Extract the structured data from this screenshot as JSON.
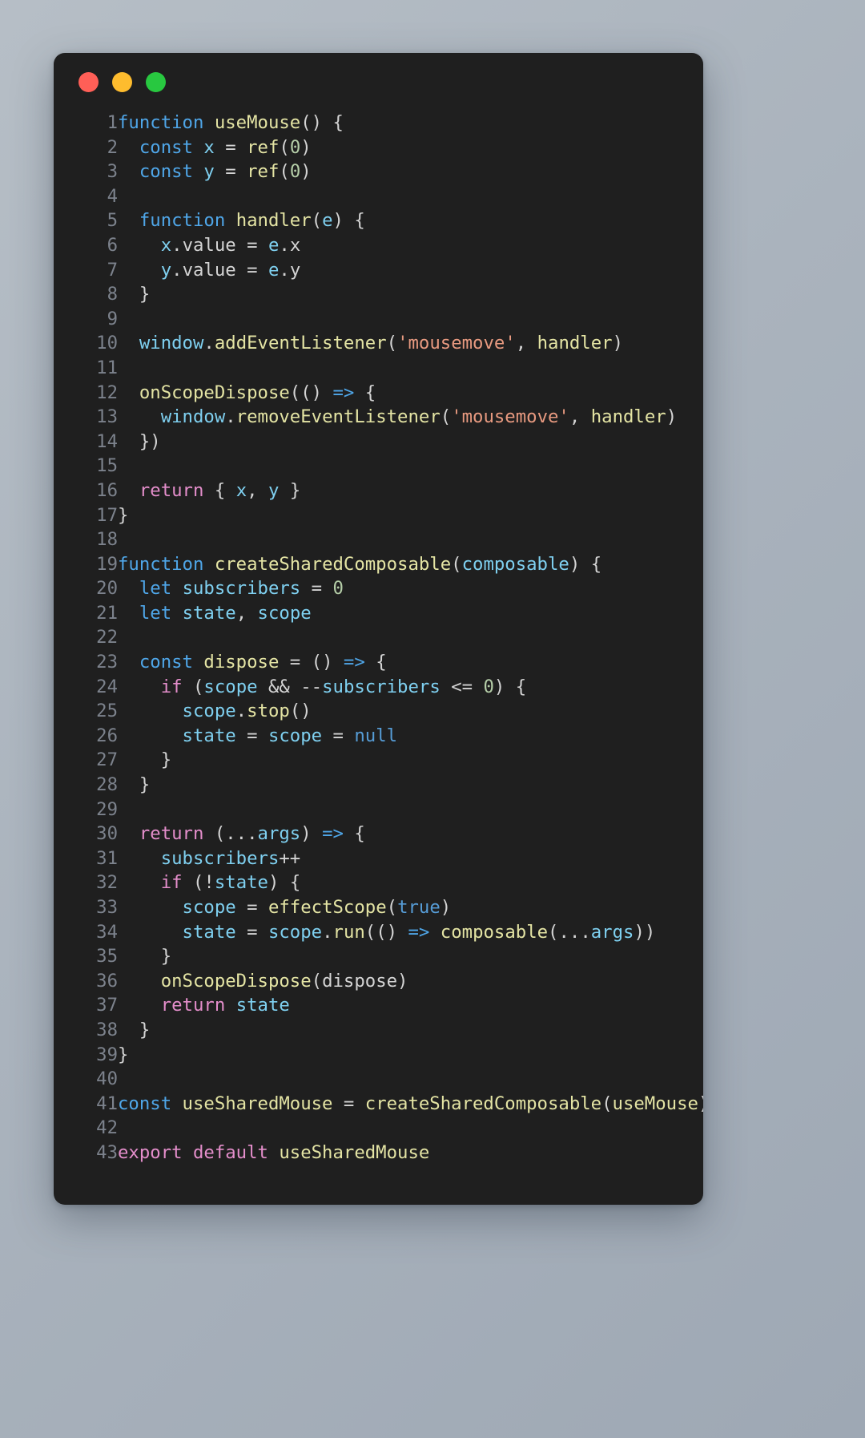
{
  "window": {
    "traffic_lights": [
      {
        "name": "close-button",
        "color": "#ff5f57"
      },
      {
        "name": "minimize-button",
        "color": "#febc2e"
      },
      {
        "name": "maximize-button",
        "color": "#28c840"
      }
    ],
    "background": "#1f1f1f"
  },
  "theme": {
    "page_background_start": "#b6bec6",
    "page_background_end": "#9ea8b4",
    "keyword": "#4fa6e8",
    "control": "#e48ecb",
    "function": "#e4e4a4",
    "variable": "#7fd0f0",
    "number": "#b5cea8",
    "string": "#e89a80",
    "literal": "#569cd6",
    "plain": "#d4d4d4",
    "line_number": "#7c828c"
  },
  "code": {
    "language": "javascript",
    "line_numbers": [
      "1",
      "2",
      "3",
      "4",
      "5",
      "6",
      "7",
      "8",
      "9",
      "10",
      "11",
      "12",
      "13",
      "14",
      "15",
      "16",
      "17",
      "18",
      "19",
      "20",
      "21",
      "22",
      "23",
      "24",
      "25",
      "26",
      "27",
      "28",
      "29",
      "30",
      "31",
      "32",
      "33",
      "34",
      "35",
      "36",
      "37",
      "38",
      "39",
      "40",
      "41",
      "42",
      "43"
    ],
    "lines": [
      "function useMouse() {",
      "  const x = ref(0)",
      "  const y = ref(0)",
      "",
      "  function handler(e) {",
      "    x.value = e.x",
      "    y.value = e.y",
      "  }",
      "",
      "  window.addEventListener('mousemove', handler)",
      "",
      "  onScopeDispose(() => {",
      "    window.removeEventListener('mousemove', handler)",
      "  })",
      "",
      "  return { x, y }",
      "}",
      "",
      "function createSharedComposable(composable) {",
      "  let subscribers = 0",
      "  let state, scope",
      "",
      "  const dispose = () => {",
      "    if (scope && --subscribers <= 0) {",
      "      scope.stop()",
      "      state = scope = null",
      "    }",
      "  }",
      "",
      "  return (...args) => {",
      "    subscribers++",
      "    if (!state) {",
      "      scope = effectScope(true)",
      "      state = scope.run(() => composable(...args))",
      "    }",
      "    onScopeDispose(dispose)",
      "    return state",
      "  }",
      "}",
      "",
      "const useSharedMouse = createSharedComposable(useMouse)",
      "",
      "export default useSharedMouse"
    ],
    "tokens": [
      [
        [
          "function ",
          "kw"
        ],
        [
          "useMouse",
          "fn"
        ],
        [
          "() {",
          "op"
        ]
      ],
      [
        [
          "  ",
          "pln"
        ],
        [
          "const ",
          "kw"
        ],
        [
          "x",
          "var"
        ],
        [
          " = ",
          "op"
        ],
        [
          "ref",
          "fn"
        ],
        [
          "(",
          "op"
        ],
        [
          "0",
          "num"
        ],
        [
          ")",
          "op"
        ]
      ],
      [
        [
          "  ",
          "pln"
        ],
        [
          "const ",
          "kw"
        ],
        [
          "y",
          "var"
        ],
        [
          " = ",
          "op"
        ],
        [
          "ref",
          "fn"
        ],
        [
          "(",
          "op"
        ],
        [
          "0",
          "num"
        ],
        [
          ")",
          "op"
        ]
      ],
      [
        [
          "",
          "pln"
        ]
      ],
      [
        [
          "  ",
          "pln"
        ],
        [
          "function ",
          "kw"
        ],
        [
          "handler",
          "fn"
        ],
        [
          "(",
          "op"
        ],
        [
          "e",
          "var"
        ],
        [
          ") {",
          "op"
        ]
      ],
      [
        [
          "    ",
          "pln"
        ],
        [
          "x",
          "var"
        ],
        [
          ".value = ",
          "op"
        ],
        [
          "e",
          "var"
        ],
        [
          ".x",
          "op"
        ]
      ],
      [
        [
          "    ",
          "pln"
        ],
        [
          "y",
          "var"
        ],
        [
          ".value = ",
          "op"
        ],
        [
          "e",
          "var"
        ],
        [
          ".y",
          "op"
        ]
      ],
      [
        [
          "  }",
          "op"
        ]
      ],
      [
        [
          "",
          "pln"
        ]
      ],
      [
        [
          "  ",
          "pln"
        ],
        [
          "window",
          "var"
        ],
        [
          ".",
          "op"
        ],
        [
          "addEventListener",
          "fn"
        ],
        [
          "(",
          "op"
        ],
        [
          "'mousemove'",
          "str"
        ],
        [
          ", ",
          "op"
        ],
        [
          "handler",
          "fn"
        ],
        [
          ")",
          "op"
        ]
      ],
      [
        [
          "",
          "pln"
        ]
      ],
      [
        [
          "  ",
          "pln"
        ],
        [
          "onScopeDispose",
          "fn"
        ],
        [
          "(() ",
          "op"
        ],
        [
          "=>",
          "arw"
        ],
        [
          " {",
          "op"
        ]
      ],
      [
        [
          "    ",
          "pln"
        ],
        [
          "window",
          "var"
        ],
        [
          ".",
          "op"
        ],
        [
          "removeEventListener",
          "fn"
        ],
        [
          "(",
          "op"
        ],
        [
          "'mousemove'",
          "str"
        ],
        [
          ", ",
          "op"
        ],
        [
          "handler",
          "fn"
        ],
        [
          ")",
          "op"
        ]
      ],
      [
        [
          "  })",
          "op"
        ]
      ],
      [
        [
          "",
          "pln"
        ]
      ],
      [
        [
          "  ",
          "pln"
        ],
        [
          "return",
          "ctl"
        ],
        [
          " { ",
          "op"
        ],
        [
          "x",
          "var"
        ],
        [
          ", ",
          "op"
        ],
        [
          "y",
          "var"
        ],
        [
          " }",
          "op"
        ]
      ],
      [
        [
          "}",
          "op"
        ]
      ],
      [
        [
          "",
          "pln"
        ]
      ],
      [
        [
          "function ",
          "kw"
        ],
        [
          "createSharedComposable",
          "fn"
        ],
        [
          "(",
          "op"
        ],
        [
          "composable",
          "var"
        ],
        [
          ") {",
          "op"
        ]
      ],
      [
        [
          "  ",
          "pln"
        ],
        [
          "let ",
          "kw"
        ],
        [
          "subscribers",
          "var"
        ],
        [
          " = ",
          "op"
        ],
        [
          "0",
          "num"
        ]
      ],
      [
        [
          "  ",
          "pln"
        ],
        [
          "let ",
          "kw"
        ],
        [
          "state",
          "var"
        ],
        [
          ", ",
          "op"
        ],
        [
          "scope",
          "var"
        ]
      ],
      [
        [
          "",
          "pln"
        ]
      ],
      [
        [
          "  ",
          "pln"
        ],
        [
          "const ",
          "kw"
        ],
        [
          "dispose",
          "fn"
        ],
        [
          " = () ",
          "op"
        ],
        [
          "=>",
          "arw"
        ],
        [
          " {",
          "op"
        ]
      ],
      [
        [
          "    ",
          "pln"
        ],
        [
          "if",
          "ctl"
        ],
        [
          " (",
          "op"
        ],
        [
          "scope",
          "var"
        ],
        [
          " && --",
          "op"
        ],
        [
          "subscribers",
          "var"
        ],
        [
          " <= ",
          "op"
        ],
        [
          "0",
          "num"
        ],
        [
          ") {",
          "op"
        ]
      ],
      [
        [
          "      ",
          "pln"
        ],
        [
          "scope",
          "var"
        ],
        [
          ".",
          "op"
        ],
        [
          "stop",
          "fn"
        ],
        [
          "()",
          "op"
        ]
      ],
      [
        [
          "      ",
          "pln"
        ],
        [
          "state",
          "var"
        ],
        [
          " = ",
          "op"
        ],
        [
          "scope",
          "var"
        ],
        [
          " = ",
          "op"
        ],
        [
          "null",
          "lit"
        ]
      ],
      [
        [
          "    }",
          "op"
        ]
      ],
      [
        [
          "  }",
          "op"
        ]
      ],
      [
        [
          "",
          "pln"
        ]
      ],
      [
        [
          "  ",
          "pln"
        ],
        [
          "return",
          "ctl"
        ],
        [
          " (...",
          "op"
        ],
        [
          "args",
          "var"
        ],
        [
          ") ",
          "op"
        ],
        [
          "=>",
          "arw"
        ],
        [
          " {",
          "op"
        ]
      ],
      [
        [
          "    ",
          "pln"
        ],
        [
          "subscribers",
          "var"
        ],
        [
          "++",
          "op"
        ]
      ],
      [
        [
          "    ",
          "pln"
        ],
        [
          "if",
          "ctl"
        ],
        [
          " (!",
          "op"
        ],
        [
          "state",
          "var"
        ],
        [
          ") {",
          "op"
        ]
      ],
      [
        [
          "      ",
          "pln"
        ],
        [
          "scope",
          "var"
        ],
        [
          " = ",
          "op"
        ],
        [
          "effectScope",
          "fn"
        ],
        [
          "(",
          "op"
        ],
        [
          "true",
          "lit"
        ],
        [
          ")",
          "op"
        ]
      ],
      [
        [
          "      ",
          "pln"
        ],
        [
          "state",
          "var"
        ],
        [
          " = ",
          "op"
        ],
        [
          "scope",
          "var"
        ],
        [
          ".",
          "op"
        ],
        [
          "run",
          "fn"
        ],
        [
          "(() ",
          "op"
        ],
        [
          "=>",
          "arw"
        ],
        [
          " ",
          "op"
        ],
        [
          "composable",
          "fn"
        ],
        [
          "(...",
          "op"
        ],
        [
          "args",
          "var"
        ],
        [
          "))",
          "op"
        ]
      ],
      [
        [
          "    }",
          "op"
        ]
      ],
      [
        [
          "    ",
          "pln"
        ],
        [
          "onScopeDispose",
          "fn"
        ],
        [
          "(",
          "op"
        ],
        [
          "dispose",
          "pln"
        ],
        [
          ")",
          "op"
        ]
      ],
      [
        [
          "    ",
          "pln"
        ],
        [
          "return",
          "ctl"
        ],
        [
          " ",
          "op"
        ],
        [
          "state",
          "var"
        ]
      ],
      [
        [
          "  }",
          "op"
        ]
      ],
      [
        [
          "}",
          "op"
        ]
      ],
      [
        [
          "",
          "pln"
        ]
      ],
      [
        [
          "const ",
          "kw"
        ],
        [
          "useSharedMouse",
          "fn"
        ],
        [
          " = ",
          "op"
        ],
        [
          "createSharedComposable",
          "fn"
        ],
        [
          "(",
          "op"
        ],
        [
          "useMouse",
          "fn"
        ],
        [
          ")",
          "op"
        ]
      ],
      [
        [
          "",
          "pln"
        ]
      ],
      [
        [
          "export default ",
          "ctl"
        ],
        [
          "useSharedMouse",
          "fn"
        ]
      ]
    ]
  }
}
